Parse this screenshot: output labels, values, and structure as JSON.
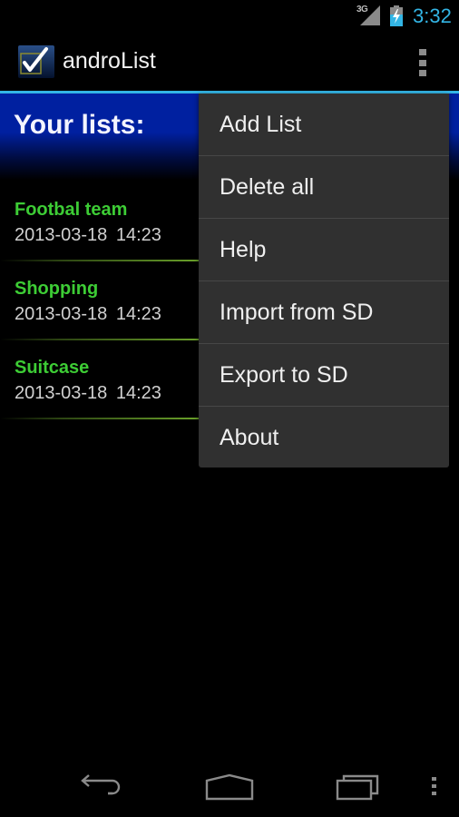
{
  "status_bar": {
    "network_label": "3G",
    "network_icon": "signal-icon",
    "battery_icon": "battery-charging-icon",
    "time": "3:32",
    "accent_color": "#33b5e5"
  },
  "action_bar": {
    "app_icon": "checkbox-app-icon",
    "title": "androList",
    "overflow_icon": "overflow-menu-icon"
  },
  "header": {
    "title": "Your lists:",
    "background_color": "#0020a0"
  },
  "lists": [
    {
      "name": "Footbal team",
      "date": "2013-03-18  14:23"
    },
    {
      "name": "Shopping",
      "date": "2013-03-18  14:23"
    },
    {
      "name": "Suitcase",
      "date": "2013-03-18  14:23"
    }
  ],
  "list_name_color": "#3dcc35",
  "menu": {
    "items": [
      {
        "label": "Add List"
      },
      {
        "label": "Delete all"
      },
      {
        "label": "Help"
      },
      {
        "label": "Import from SD"
      },
      {
        "label": "Export to SD"
      },
      {
        "label": "About"
      }
    ]
  },
  "nav_bar": {
    "back_icon": "back-icon",
    "home_icon": "home-icon",
    "recents_icon": "recent-apps-icon",
    "menu_icon": "overflow-menu-icon"
  }
}
